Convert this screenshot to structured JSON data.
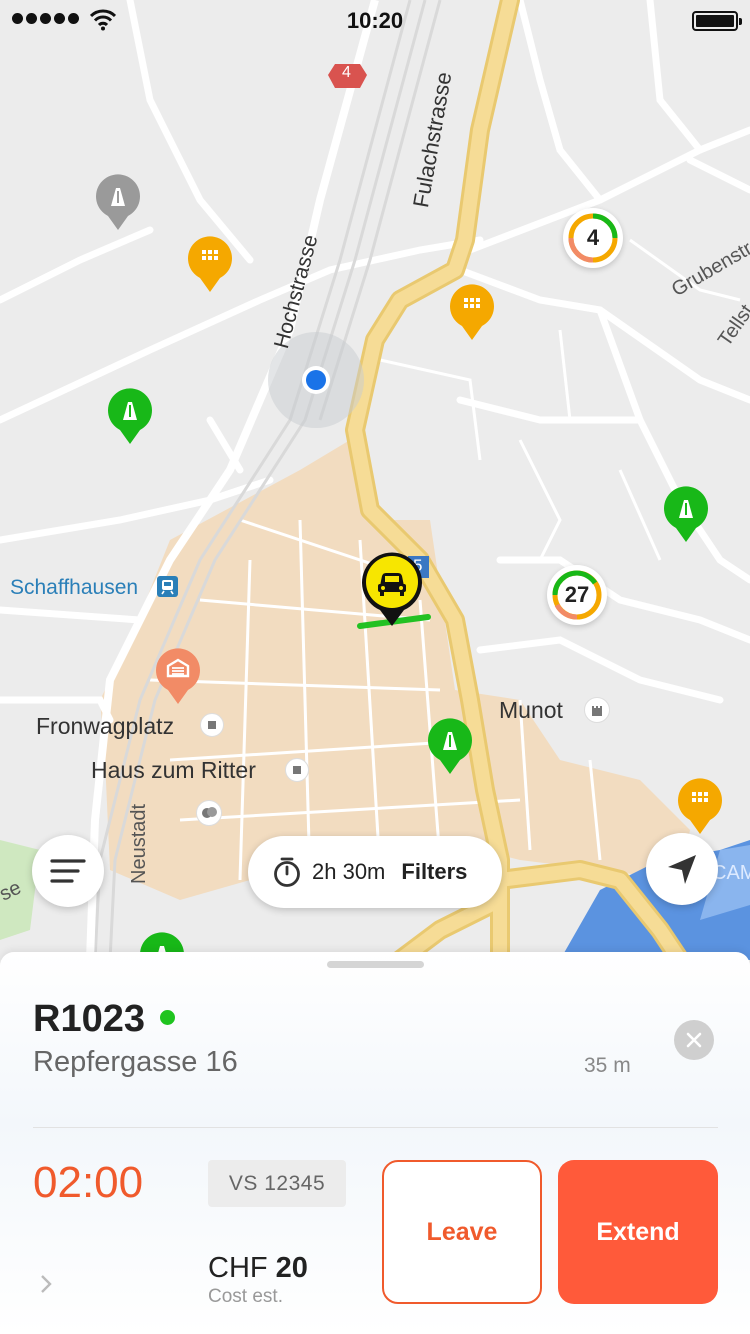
{
  "status_bar": {
    "time": "10:20"
  },
  "map": {
    "labels": {
      "fulachstrasse": "Fulachstrasse",
      "hochstrasse": "Hochstrasse",
      "grubenstrasse": "Grubenstr",
      "tellstrasse": "Tellst",
      "schaffhausen": "Schaffhausen",
      "fronwagplatz": "Fronwagplatz",
      "haus_zum_ritter": "Haus zum Ritter",
      "munot": "Munot",
      "neustadt": "Neustadt",
      "road_badge_4": "4",
      "road_badge_5": "5",
      "edge_se": "se",
      "edge_cam": "CAM"
    },
    "clusters": {
      "cluster_a": "4",
      "cluster_b": "27"
    },
    "colors": {
      "green_pin": "#18b818",
      "yellow_pin": "#f5a800",
      "grey_pin": "#9a9a9a",
      "orange_pin": "#f28b66",
      "road": "#f6dc96",
      "old_town": "#f2dcc0"
    }
  },
  "filter_pill": {
    "duration": "2h 30m",
    "filters_label": "Filters"
  },
  "sheet": {
    "title": "R1023",
    "address": "Repfergasse 16",
    "distance": "35 m",
    "timer": "02:00",
    "plate": "VS 12345",
    "cost_currency": "CHF",
    "cost_value": "20",
    "cost_label": "Cost est.",
    "leave_label": "Leave",
    "extend_label": "Extend",
    "accent": "#f05a2c"
  }
}
